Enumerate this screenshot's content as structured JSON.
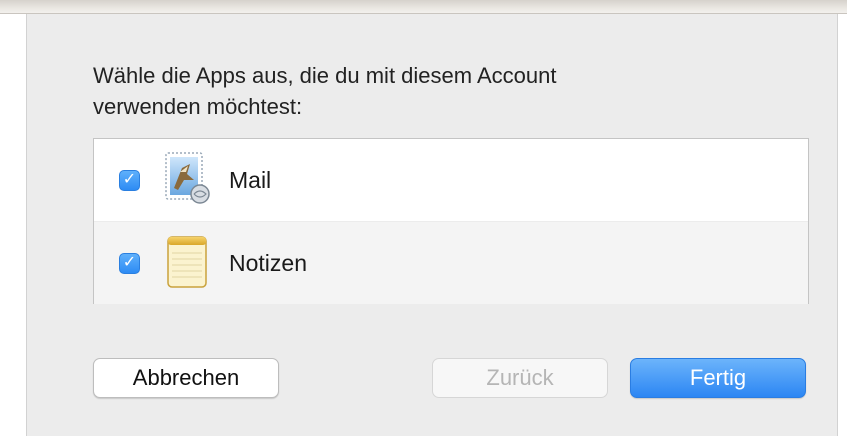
{
  "dialog": {
    "prompt_line1": "Wähle die Apps aus, die du mit diesem Account",
    "prompt_line2": "verwenden möchtest:"
  },
  "apps": [
    {
      "label": "Mail",
      "checked": true,
      "icon": "mail-app-icon"
    },
    {
      "label": "Notizen",
      "checked": true,
      "icon": "notes-app-icon"
    }
  ],
  "buttons": {
    "cancel_label": "Abbrechen",
    "back_label": "Zurück",
    "done_label": "Fertig"
  },
  "colors": {
    "accent": "#2d8bf4",
    "dialog_background": "#ececec",
    "disabled_text": "#b5b5b5"
  }
}
